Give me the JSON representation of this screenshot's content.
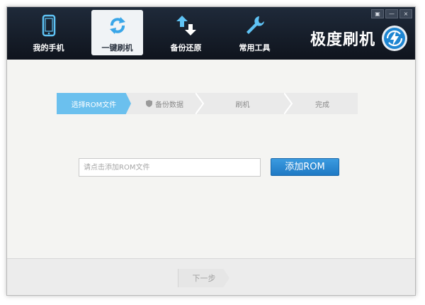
{
  "window": {
    "controls": {
      "menu_icon": "menu-icon",
      "min_label": "—",
      "close_label": "×"
    }
  },
  "nav": {
    "items": [
      {
        "label": "我的手机",
        "icon": "phone-icon"
      },
      {
        "label": "一键刷机",
        "icon": "refresh-icon",
        "active": true
      },
      {
        "label": "备份还原",
        "icon": "updown-arrows-icon"
      },
      {
        "label": "常用工具",
        "icon": "wrench-icon"
      }
    ]
  },
  "brand": {
    "name": "极度刷机",
    "icon": "lightning-refresh-logo"
  },
  "steps": [
    {
      "label": "选择ROM文件",
      "active": true
    },
    {
      "label": "备份数据",
      "icon": "shield-icon"
    },
    {
      "label": "刷机"
    },
    {
      "label": "完成"
    }
  ],
  "rom": {
    "placeholder": "请点击添加ROM文件",
    "button_label": "添加ROM"
  },
  "footer": {
    "next_label": "下一步"
  },
  "colors": {
    "header": "#141a24",
    "accent": "#2a8ad4",
    "step_active": "#6bc0ee",
    "background": "#f4f4f2"
  }
}
